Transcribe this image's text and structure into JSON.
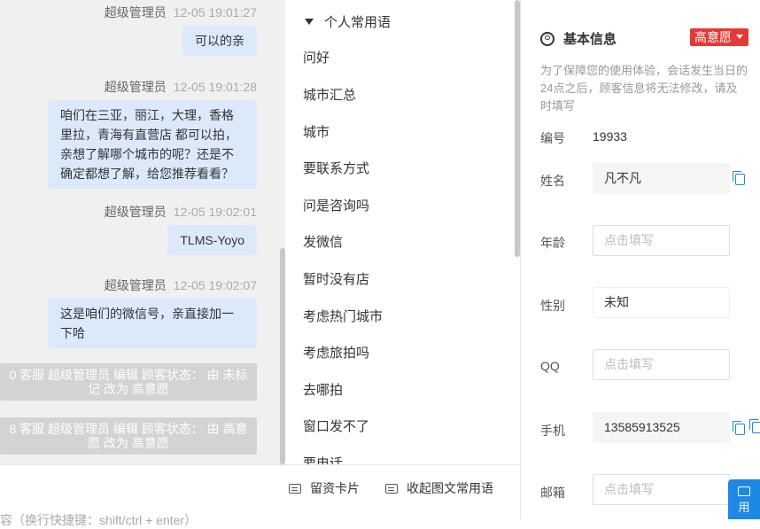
{
  "chat": {
    "messages": [
      {
        "sender": "超级管理员",
        "time": "12-05 19:01:27",
        "text": "可以的亲"
      },
      {
        "sender": "超级管理员",
        "time": "12-05 19:01:28",
        "text": "咱们在三亚，丽江，大理，香格里拉，青海有直营店 都可以拍，亲想了解哪个城市的呢？还是不确定都想了解，给您推荐看看？"
      },
      {
        "sender": "超级管理员",
        "time": "12-05 19:02:01",
        "text": "TLMS-Yoyo"
      },
      {
        "sender": "超级管理员",
        "time": "12-05 19:02:07",
        "text": "这是咱们的微信号，亲直接加一下哈"
      }
    ],
    "system_messages": [
      "0 客服 超级管理员 编辑 顾客状态： 由 未标记 改为 高意愿",
      "8 客服 超级管理员 编辑 顾客状态： 由 高意愿 改为 高意愿"
    ]
  },
  "phrases": {
    "header": "个人常用语",
    "items": [
      "问好",
      "城市汇总",
      "城市",
      "要联系方式",
      "问是咨询吗",
      "发微信",
      "暂时没有店",
      "考虑热门城市",
      "考虑旅拍吗",
      "去哪拍",
      "窗口发不了",
      "要电话"
    ]
  },
  "toolbar": {
    "card_button": "留资卡片",
    "collapse_button": "收起图文常用语",
    "input_hint": "容（换行快捷键：shift/ctrl + enter）"
  },
  "info": {
    "title": "基本信息",
    "intent": "高意愿",
    "notice": "为了保障您的使用体验，会话发生当日的24点之后，顾客信息将无法修改，请及时填写",
    "id_label": "编号",
    "id_value": "19933",
    "name_label": "姓名",
    "name_value": "凡不凡",
    "age_label": "年龄",
    "age_placeholder": "点击填写",
    "gender_label": "性别",
    "gender_value": "未知",
    "qq_label": "QQ",
    "qq_placeholder": "点击填写",
    "phone_label": "手机",
    "phone_value": "13585913525",
    "email_label": "邮箱",
    "email_placeholder": "点击填写",
    "float_button": "用"
  },
  "colors": {
    "accent": "#1e88e5",
    "badge": "#e53935",
    "bubble": "#dce9fb"
  }
}
